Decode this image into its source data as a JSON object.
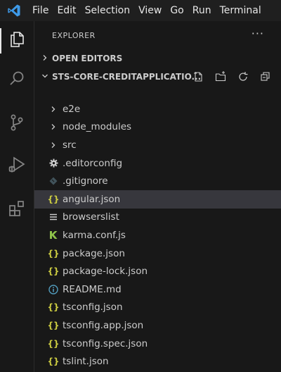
{
  "menu": [
    "File",
    "Edit",
    "Selection",
    "View",
    "Go",
    "Run",
    "Terminal"
  ],
  "explorer": {
    "title": "EXPLORER",
    "more": "···",
    "open_editors": "OPEN EDITORS",
    "project": "STS-CORE-CREDITAPPLICATIO...",
    "items": [
      {
        "label": "e2e",
        "icon": "chevron-right",
        "type": "folder"
      },
      {
        "label": "node_modules",
        "icon": "chevron-right",
        "type": "folder"
      },
      {
        "label": "src",
        "icon": "chevron-right",
        "type": "folder"
      },
      {
        "label": ".editorconfig",
        "icon": "gear",
        "type": "file"
      },
      {
        "label": ".gitignore",
        "icon": "git",
        "type": "file"
      },
      {
        "label": "angular.json",
        "icon": "braces",
        "type": "file",
        "selected": true
      },
      {
        "label": "browserslist",
        "icon": "lines",
        "type": "file"
      },
      {
        "label": "karma.conf.js",
        "icon": "karma",
        "type": "file"
      },
      {
        "label": "package.json",
        "icon": "braces",
        "type": "file"
      },
      {
        "label": "package-lock.json",
        "icon": "braces",
        "type": "file"
      },
      {
        "label": "README.md",
        "icon": "info",
        "type": "file"
      },
      {
        "label": "tsconfig.json",
        "icon": "braces",
        "type": "file"
      },
      {
        "label": "tsconfig.app.json",
        "icon": "braces",
        "type": "file"
      },
      {
        "label": "tsconfig.spec.json",
        "icon": "braces",
        "type": "file"
      },
      {
        "label": "tslint.json",
        "icon": "braces",
        "type": "file"
      }
    ]
  },
  "colors": {
    "vscode_blue": "#3e9ae8",
    "json_yellow": "#cbcb41",
    "info_blue": "#519aba",
    "karma_green": "#8dc149",
    "selection": "#37373d"
  }
}
